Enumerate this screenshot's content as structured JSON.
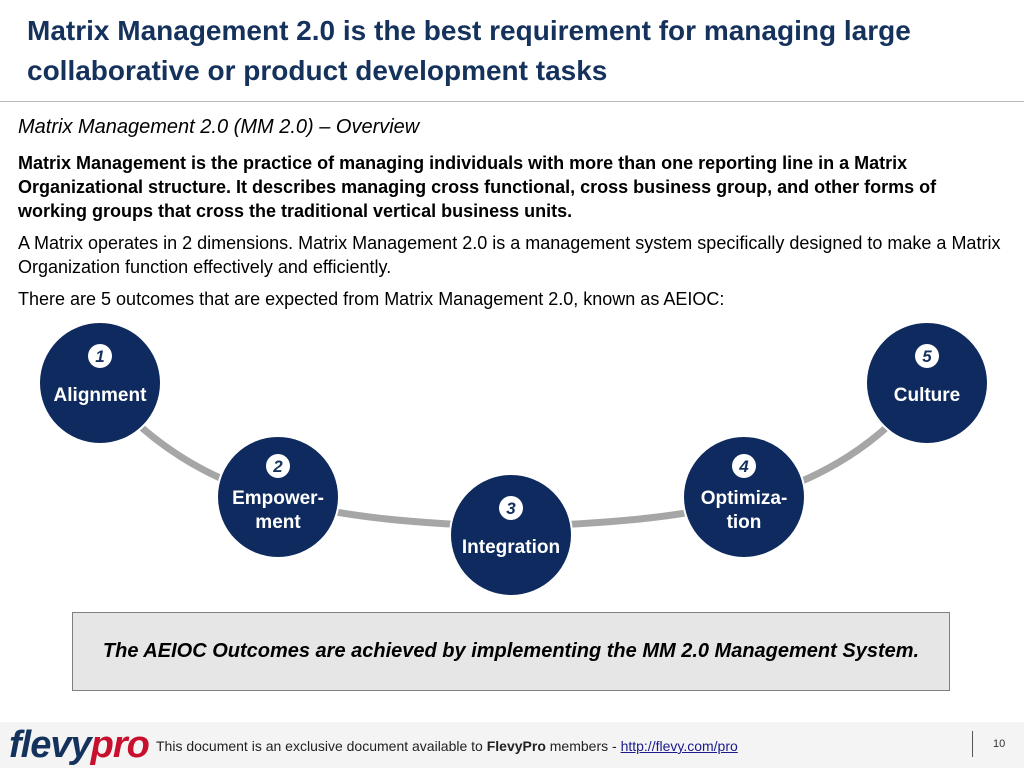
{
  "header": {
    "title": "Matrix Management 2.0 is the best requirement for managing large collaborative or product development tasks"
  },
  "overview": {
    "subtitle": "Matrix Management 2.0 (MM 2.0) – Overview",
    "paragraph_bold": "Matrix Management is the practice of managing individuals with more than one reporting line in a Matrix Organizational structure.  It describes managing cross functional, cross business group, and other forms of working groups that cross the traditional vertical business units.",
    "paragraph_2": "A Matrix operates in 2 dimensions.  Matrix Management 2.0 is a management system specifically designed to make a Matrix Organization function effectively and efficiently.",
    "paragraph_3": "There are 5 outcomes that are expected from Matrix Management 2.0, known as AEIOC:"
  },
  "outcomes": [
    {
      "number": "1",
      "line1": "Alignment",
      "line2": ""
    },
    {
      "number": "2",
      "line1": "Empower-",
      "line2": "ment"
    },
    {
      "number": "3",
      "line1": "Integration",
      "line2": ""
    },
    {
      "number": "4",
      "line1": "Optimiza-",
      "line2": "tion"
    },
    {
      "number": "5",
      "line1": "Culture",
      "line2": ""
    }
  ],
  "callout": {
    "text": "The AEIOC Outcomes are achieved by implementing the MM 2.0 Management System."
  },
  "footer": {
    "logo_part1": "flevy",
    "logo_part2": "pro",
    "text_before": "This document is an exclusive document available to ",
    "brand": "FlevyPro",
    "text_after": " members - ",
    "link": "http://flevy.com/pro",
    "page_number": "10"
  },
  "colors": {
    "title": "#14325c",
    "circle_fill": "#0e2a5e",
    "arc": "#a6a6a6",
    "logo_red": "#c8102e"
  }
}
